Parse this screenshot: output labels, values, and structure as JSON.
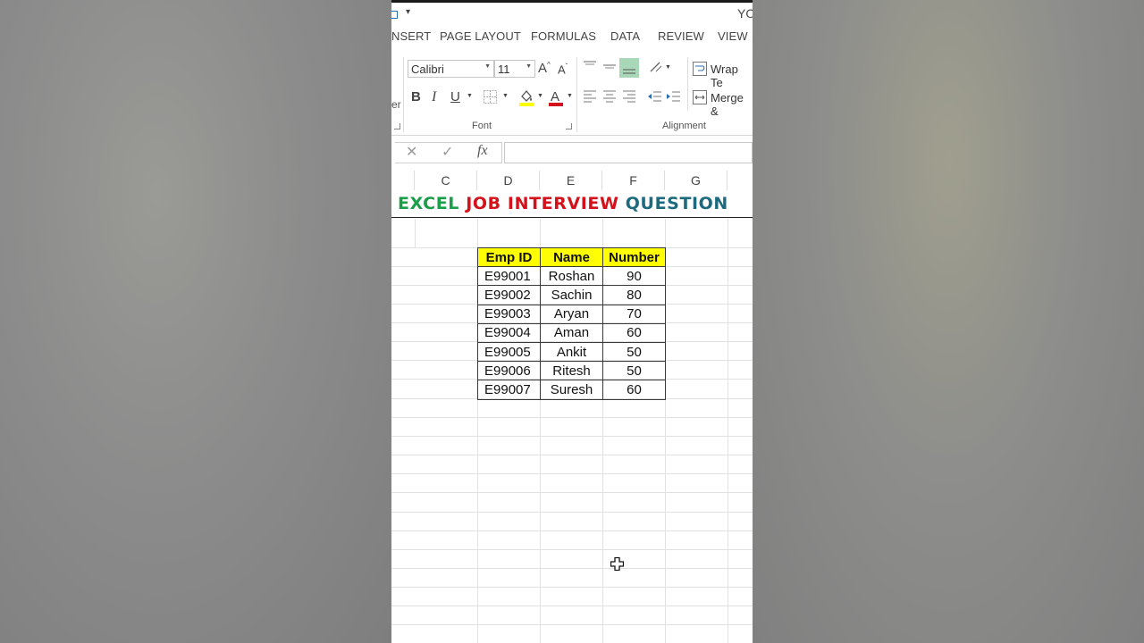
{
  "title_partial": "YO",
  "tabs": [
    "NSERT",
    "PAGE LAYOUT",
    "FORMULAS",
    "DATA",
    "REVIEW",
    "VIEW"
  ],
  "clipboard_partial": "er",
  "font": {
    "name": "Calibri",
    "size": "11",
    "label": "Font"
  },
  "alignment": {
    "wrap_text": "Wrap Te",
    "merge": "Merge &",
    "label": "Alignment"
  },
  "formula_bar": {
    "cancel_glyph": "✕",
    "enter_glyph": "✓",
    "fx_glyph": "fx",
    "value": ""
  },
  "columns": [
    "C",
    "D",
    "E",
    "F",
    "G"
  ],
  "banner": {
    "word1": "EXCEL",
    "word2": "JOB INTERVIEW",
    "word3": "QUESTION"
  },
  "table": {
    "headers": [
      "Emp ID",
      "Name",
      "Number"
    ],
    "rows": [
      [
        "E99001",
        "Roshan",
        "90"
      ],
      [
        "E99002",
        "Sachin",
        "80"
      ],
      [
        "E99003",
        "Aryan",
        "70"
      ],
      [
        "E99004",
        "Aman",
        "60"
      ],
      [
        "E99005",
        "Ankit",
        "50"
      ],
      [
        "E99006",
        "Ritesh",
        "50"
      ],
      [
        "E99007",
        "Suresh",
        "60"
      ]
    ]
  },
  "colors": {
    "header_fill": "#ffff00",
    "banner_green": "#1a9e4a",
    "banner_red": "#d4121b",
    "banner_teal": "#1d6a7f"
  }
}
